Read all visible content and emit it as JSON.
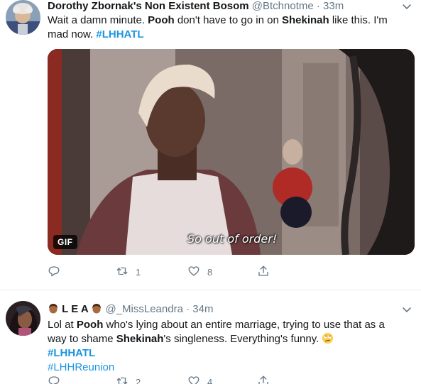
{
  "tweets": [
    {
      "display_name": "Dorothy Zbornak's Non Existent Bosom",
      "handle": "@Btchnotme",
      "separator": "·",
      "time": "33m",
      "text": {
        "p1": "Wait a damn minute.  ",
        "mention1": "Pooh",
        "p2": " don't have to go in on ",
        "mention2": "Shekinah",
        "p3": " like this.  I'm mad now.  ",
        "hashtag": "#LHHATL"
      },
      "media": {
        "badge": "GIF",
        "subtitle": "So out of order!"
      },
      "actions": {
        "reply_count": "",
        "retweet_count": "1",
        "like_count": "8"
      }
    },
    {
      "display_name_left": "L E A",
      "handle": "@_MissLeandra",
      "separator": "·",
      "time": "34m",
      "text": {
        "p1": "Lol at ",
        "mention1": "Pooh",
        "p2": " who's lying about an entire marriage, trying to use that as a way to shame ",
        "mention2": "Shekinah",
        "p3": "'s singleness. Everything's funny. ",
        "hashtag1": "#LHHATL",
        "hashtag2": "#LHHReunion"
      },
      "actions": {
        "reply_count": "",
        "retweet_count": "2",
        "like_count": "4"
      }
    }
  ],
  "icons": {
    "reply": "reply-icon",
    "retweet": "retweet-icon",
    "like": "heart-icon",
    "share": "share-icon",
    "caret": "chevron-down-icon",
    "emoji": "rolling-eyes-emoji"
  },
  "colors": {
    "hashtag": "#1b95e0",
    "secondary": "#657786",
    "divider": "#e6ecf0"
  }
}
